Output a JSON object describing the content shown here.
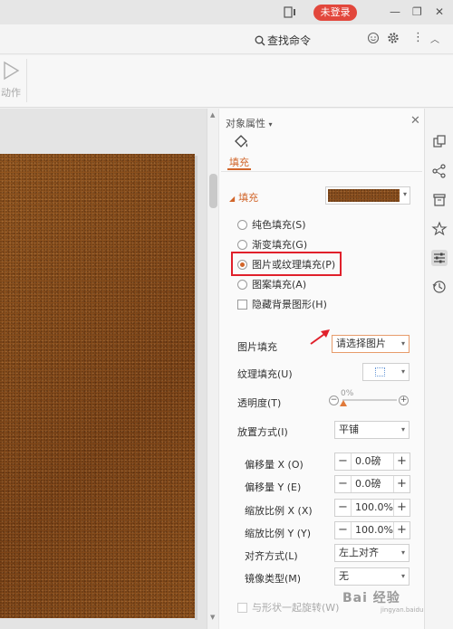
{
  "titlebar": {
    "login_label": "未登录"
  },
  "toolbar": {
    "search_label": "查找命令"
  },
  "ribbon": {
    "action_label": "动作"
  },
  "panel": {
    "title": "对象属性",
    "title_caret": "▾",
    "tab_fill": "填充",
    "section_fill": "填充",
    "fill_options": [
      {
        "label": "纯色填充(S)",
        "selected": false
      },
      {
        "label": "渐变填充(G)",
        "selected": false
      },
      {
        "label": "图片或纹理填充(P)",
        "selected": true
      },
      {
        "label": "图案填充(A)",
        "selected": false
      }
    ],
    "hide_background_label": "隐藏背景图形(H)",
    "picture_fill_label": "图片填充",
    "picture_fill_value": "请选择图片",
    "texture_fill_label": "纹理填充(U)",
    "transparency_label": "透明度(T)",
    "transparency_value": "0%",
    "placement_label": "放置方式(I)",
    "placement_value": "平铺",
    "offset_x_label": "偏移量 X (O)",
    "offset_x_value": "0.0磅",
    "offset_y_label": "偏移量 Y (E)",
    "offset_y_value": "0.0磅",
    "scale_x_label": "缩放比例 X (X)",
    "scale_x_value": "100.0%",
    "scale_y_label": "缩放比例 Y (Y)",
    "scale_y_value": "100.0%",
    "align_label": "对齐方式(L)",
    "align_value": "左上对齐",
    "mirror_label": "镜像类型(M)",
    "mirror_value": "无",
    "rotate_with_shape_label": "与形状一起旋转(W)"
  },
  "watermark": {
    "text": "Bai 经验",
    "sub": "jingyan.baidu.com"
  },
  "colors": {
    "accent": "#d1652a",
    "highlight_box": "#e0202b",
    "login_btn": "#e2473c"
  }
}
